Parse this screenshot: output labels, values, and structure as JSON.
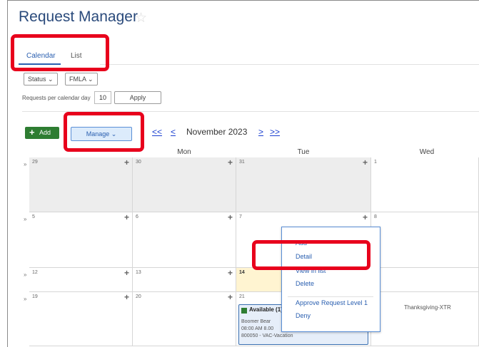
{
  "page": {
    "title": "Request Manager"
  },
  "tabs": [
    {
      "label": "Calendar"
    },
    {
      "label": "List"
    }
  ],
  "filters": {
    "status_label": "Status ⌄",
    "fmla_label": "FMLA ⌄"
  },
  "requests_per_day": {
    "label": "Requests per calendar day",
    "value": "10"
  },
  "apply_label": "Apply",
  "toolbar": {
    "add_label": "Add",
    "manage_label": "Manage ⌄",
    "prev_year": "<<",
    "prev_month": "<",
    "month_label": "November 2023",
    "next_month": ">",
    "next_year": ">>"
  },
  "day_headers": [
    "Mon",
    "Tue",
    "Wed"
  ],
  "weeks": [
    {
      "days": [
        "29",
        "30",
        "31",
        "1"
      ]
    },
    {
      "days": [
        "5",
        "6",
        "7",
        "8"
      ]
    },
    {
      "days": [
        "12",
        "13",
        "14",
        ""
      ]
    },
    {
      "days": [
        "19",
        "20",
        "21",
        ""
      ]
    }
  ],
  "week_marker": "»",
  "holiday_label": "Thanksgiving-XTR",
  "event": {
    "title": "Available (1)",
    "name": "Boomer Bear",
    "time": "08:00 AM 8.00",
    "code": "800050 - VAC-Vacation"
  },
  "context_menu": {
    "items": [
      "Add",
      "Detail",
      "View in list",
      "Delete",
      "Approve Request Level 1",
      "Deny"
    ]
  },
  "colors": {
    "accent": "#2a5fb0",
    "add_button": "#2e7d32",
    "highlight": "#e8001c",
    "today": "#fff4d1"
  }
}
